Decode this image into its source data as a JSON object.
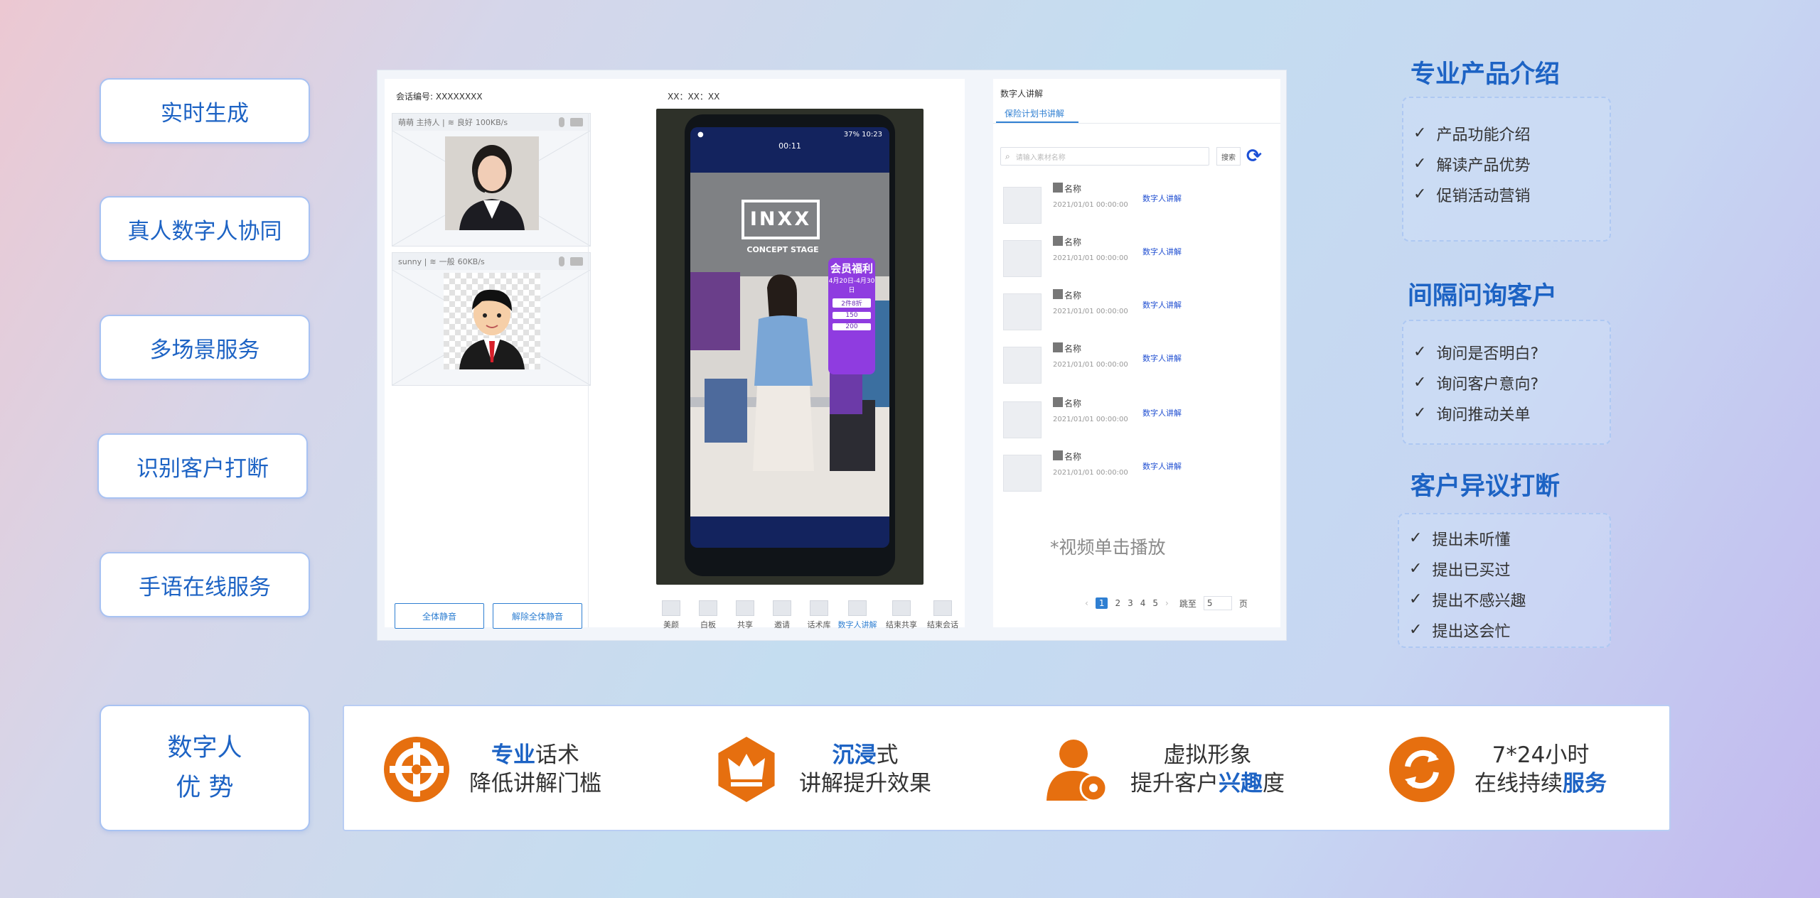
{
  "left_buttons": [
    "实时生成",
    "真人数字人协同",
    "多场景服务",
    "识别客户打断",
    "手语在线服务"
  ],
  "app": {
    "session_label": "会话编号: XXXXXXXX",
    "time_label": "XX：XX：XX",
    "participants": [
      {
        "name": "萌萌 主持人 |",
        "signal": "良好",
        "speed": "100KB/s"
      },
      {
        "name": "sunny |",
        "signal": "一般",
        "speed": "60KB/s"
      }
    ],
    "mute_all": "全体静音",
    "unmute_all": "解除全体静音",
    "phone": {
      "time": "00:11",
      "status": "37%",
      "clock": "10:23",
      "brand": "INXX",
      "stage": "CONCEPT STAGE",
      "promo": "会员福利",
      "promo_sub": "4月20日-4月30日",
      "promo_items": [
        "2件8折",
        "150",
        "200"
      ]
    },
    "toolbar": [
      "美颜",
      "白板",
      "共享",
      "邀请",
      "话术库",
      "数字人讲解",
      "结束共享",
      "结束会话"
    ],
    "right_panel": {
      "title": "数字人讲解",
      "tab": "保险计划书讲解",
      "search_placeholder": "请输入素材名称",
      "search_button": "搜索",
      "materials": [
        {
          "name": "名称",
          "time": "2021/01/01 00:00:00",
          "link": "数字人讲解"
        },
        {
          "name": "名称",
          "time": "2021/01/01 00:00:00",
          "link": "数字人讲解"
        },
        {
          "name": "名称",
          "time": "2021/01/01 00:00:00",
          "link": "数字人讲解"
        },
        {
          "name": "名称",
          "time": "2021/01/01 00:00:00",
          "link": "数字人讲解"
        },
        {
          "name": "名称",
          "time": "2021/01/01 00:00:00",
          "link": "数字人讲解"
        },
        {
          "name": "名称",
          "time": "2021/01/01 00:00:00",
          "link": "数字人讲解"
        }
      ],
      "hint": "*视频单击播放",
      "pager": {
        "prev": "‹",
        "pages": [
          "1",
          "2",
          "3",
          "4",
          "5"
        ],
        "next": "›",
        "goto_label": "跳至",
        "goto_value": "5",
        "page_label": "页"
      }
    }
  },
  "sections": [
    {
      "title": "专业产品介绍",
      "items": [
        "产品功能介绍",
        "解读产品优势",
        "促销活动营销"
      ]
    },
    {
      "title": "间隔问询客户",
      "items": [
        "询问是否明白?",
        "询问客户意向?",
        "询问推动关单"
      ]
    },
    {
      "title": "客户异议打断",
      "items": [
        "提出未听懂",
        "提出已买过",
        "提出不感兴趣",
        "提出这会忙"
      ]
    }
  ],
  "bottom": {
    "label_line1": "数字人",
    "label_line2": "优 势",
    "features": [
      {
        "l1a": "专业",
        "l1b": "话术",
        "l2a": "降低讲解门槛",
        "l2b": ""
      },
      {
        "l1a": "沉浸",
        "l1b": "式",
        "l2a": "讲解提升效果",
        "l2b": ""
      },
      {
        "l1a": "",
        "l1b": "虚拟形象",
        "l2a": "提升客户",
        "l2b": "兴趣",
        "l2c": "度"
      },
      {
        "l1a": "",
        "l1b": "7*24小时",
        "l2a": "在线持续",
        "l2b": "服务"
      }
    ]
  },
  "colors": {
    "accent": "#1d63c4",
    "orange": "#e66f0f"
  }
}
